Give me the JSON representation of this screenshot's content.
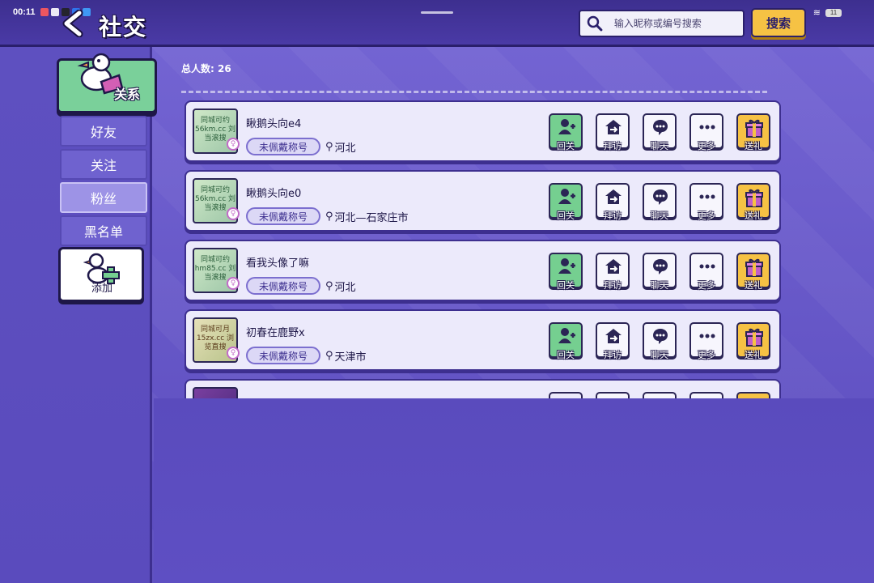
{
  "status_bar": {
    "time": "00:11",
    "battery": "11"
  },
  "header": {
    "title": "社交",
    "search": {
      "placeholder": "输入昵称或编号搜索"
    },
    "search_button": "搜索"
  },
  "sidebar": {
    "relation_tab": "关系",
    "items": [
      {
        "label": "好友",
        "active": false
      },
      {
        "label": "关注",
        "active": false
      },
      {
        "label": "粉丝",
        "active": true
      },
      {
        "label": "黑名单",
        "active": false
      }
    ],
    "add_label": "添加"
  },
  "main": {
    "total_label": "总人数:",
    "total_count": "26",
    "actions": {
      "follow_back": "回关",
      "visit": "拜访",
      "chat": "聊天",
      "more": "更多",
      "gift": "送礼"
    },
    "users": [
      {
        "name": "瞅鹅头向e4",
        "title": "未佩戴称号",
        "location": "河北",
        "avatar_text": "同城可约 56km.cc 刘当滚搜"
      },
      {
        "name": "瞅鹅头向e0",
        "title": "未佩戴称号",
        "location": "河北—石家庄市",
        "avatar_text": "同城可约 56km.cc 刘当滚搜"
      },
      {
        "name": "看我头像了嘛",
        "title": "未佩戴称号",
        "location": "河北",
        "avatar_text": "同城可约 hm85.cc 刘当滚搜"
      },
      {
        "name": "初春在鹿野x",
        "title": "未佩戴称号",
        "location": "天津市",
        "avatar_text": "同城可月 15zx.cc 浏览直搜"
      }
    ]
  },
  "colors": {
    "accent_gold": "#f6c244",
    "accent_green": "#75cf90",
    "bg_purple": "#5a4bbd"
  }
}
